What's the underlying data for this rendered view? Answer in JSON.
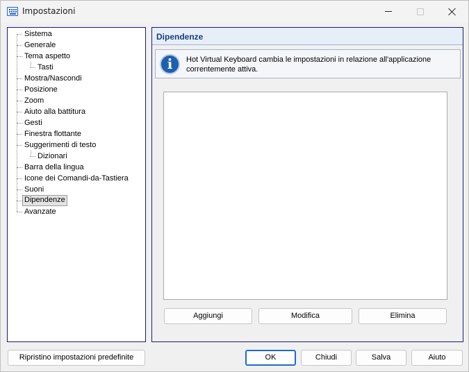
{
  "window": {
    "title": "Impostazioni"
  },
  "tree": {
    "items": [
      {
        "label": "Sistema"
      },
      {
        "label": "Generale"
      },
      {
        "label": "Tema aspetto"
      },
      {
        "label": "Tasti"
      },
      {
        "label": "Mostra/Nascondi"
      },
      {
        "label": "Posizione"
      },
      {
        "label": "Zoom"
      },
      {
        "label": "Aiuto alla battitura"
      },
      {
        "label": "Gesti"
      },
      {
        "label": "Finestra flottante"
      },
      {
        "label": "Suggerimenti di testo"
      },
      {
        "label": "Dizionari"
      },
      {
        "label": "Barra della lingua"
      },
      {
        "label": "Icone dei Comandi-da-Tastiera"
      },
      {
        "label": "Suoni"
      },
      {
        "label": "Dipendenze"
      },
      {
        "label": "Avanzate"
      }
    ],
    "selected": "Dipendenze"
  },
  "panel": {
    "title": "Dipendenze",
    "info_line1": "Hot Virtual Keyboard cambia le impostazioni in relazione all'applicazione",
    "info_line2": "correntemente attiva.",
    "buttons": {
      "add": "Aggiungi",
      "edit": "Modifica",
      "delete": "Elimina"
    }
  },
  "footer": {
    "reset": "Ripristino impostazioni predefinite",
    "ok": "OK",
    "close": "Chiudi",
    "save": "Salva",
    "help": "Aiuto"
  },
  "colors": {
    "accent": "#1e6cc8",
    "panel_border": "#1a1a7a",
    "header_text": "#1c3d7a"
  }
}
